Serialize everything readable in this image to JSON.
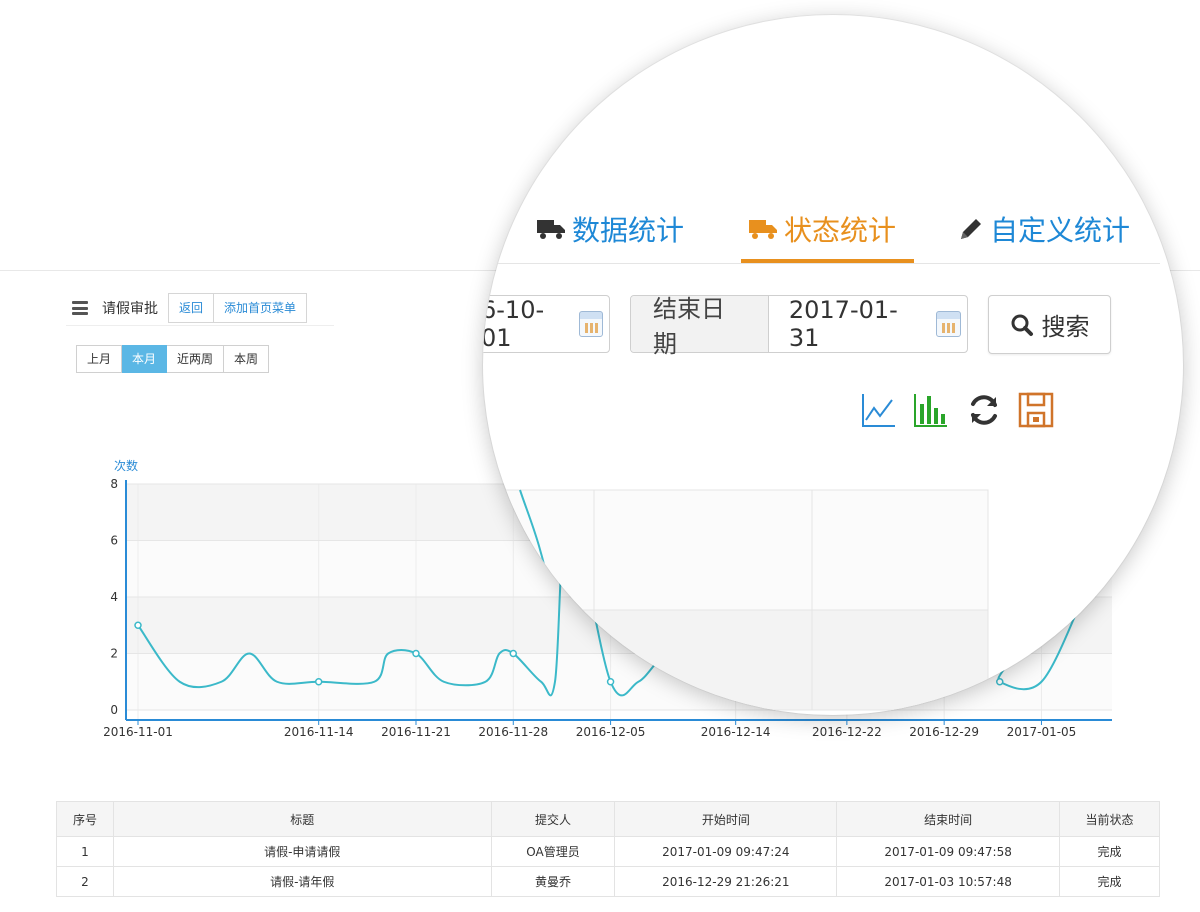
{
  "header": {
    "title": "请假审批",
    "back_label": "返回",
    "add_menu_label": "添加首页菜单"
  },
  "period_buttons": [
    "上月",
    "本月",
    "近两周",
    "本周"
  ],
  "active_period": "本月",
  "chart_data": {
    "type": "line",
    "ylabel": "次数",
    "ylim": [
      0,
      8
    ],
    "yticks": [
      0,
      2,
      4,
      6,
      8
    ],
    "x_ticks": [
      "2016-11-01",
      "2016-11-14",
      "2016-11-21",
      "2016-11-28",
      "2016-12-05",
      "2016-12-14",
      "2016-12-22",
      "2016-12-29",
      "2017-01-05"
    ],
    "series": [
      {
        "color": "#3bb9c9",
        "points": [
          {
            "x": "2016-11-01",
            "y": 3
          },
          {
            "x": "2016-11-04",
            "y": 1
          },
          {
            "x": "2016-11-07",
            "y": 1
          },
          {
            "x": "2016-11-09",
            "y": 2
          },
          {
            "x": "2016-11-11",
            "y": 1
          },
          {
            "x": "2016-11-14",
            "y": 1
          },
          {
            "x": "2016-11-18",
            "y": 1
          },
          {
            "x": "2016-11-19",
            "y": 2
          },
          {
            "x": "2016-11-21",
            "y": 2
          },
          {
            "x": "2016-11-23",
            "y": 1
          },
          {
            "x": "2016-11-26",
            "y": 1
          },
          {
            "x": "2016-11-27",
            "y": 2
          },
          {
            "x": "2016-11-28",
            "y": 2
          },
          {
            "x": "2016-11-30",
            "y": 1
          },
          {
            "x": "2016-12-01",
            "y": 1
          },
          {
            "x": "2016-12-02",
            "y": 7
          },
          {
            "x": "2016-12-05",
            "y": 1
          },
          {
            "x": "2016-12-07",
            "y": 1
          },
          {
            "x": "2016-12-09",
            "y": 2
          },
          {
            "x": "2016-12-11",
            "y": 2
          },
          {
            "x": "2016-12-14",
            "y": 1
          },
          {
            "x": "2017-01-01",
            "y": 2
          },
          {
            "x": "2017-01-02",
            "y": 1
          },
          {
            "x": "2017-01-05",
            "y": 1
          },
          {
            "x": "2017-01-08",
            "y": 4
          }
        ],
        "markers": [
          "2016-11-01",
          "2016-11-14",
          "2016-11-21",
          "2016-11-28",
          "2016-12-05",
          "2016-12-14",
          "2017-01-02"
        ]
      }
    ]
  },
  "table": {
    "columns": [
      "序号",
      "标题",
      "提交人",
      "开始时间",
      "结束时间",
      "当前状态"
    ],
    "rows": [
      [
        "1",
        "请假-申请请假",
        "OA管理员",
        "2017-01-09 09:47:24",
        "2017-01-09 09:47:58",
        "完成"
      ],
      [
        "2",
        "请假-请年假",
        "黄曼乔",
        "2016-12-29 21:26:21",
        "2017-01-03 10:57:48",
        "完成"
      ]
    ]
  },
  "magnifier": {
    "tabs": [
      {
        "label": "数据统计",
        "icon": "truck-icon",
        "color": "#1e88d6"
      },
      {
        "label": "状态统计",
        "icon": "truck-icon",
        "color": "#e8901e"
      },
      {
        "label": "自定义统计",
        "icon": "pencil-icon",
        "color": "#1e88d6"
      }
    ],
    "active_tab": "状态统计",
    "start_date_value": "6-10-01",
    "end_date_label": "结束日期",
    "end_date_value": "2017-01-31",
    "search_label": "搜索",
    "tools": [
      {
        "icon": "line-chart-icon",
        "color": "#2a8bd6"
      },
      {
        "icon": "bar-chart-icon",
        "color": "#2aa52a"
      },
      {
        "icon": "refresh-icon",
        "color": "#333333"
      },
      {
        "icon": "save-icon",
        "color": "#d0742a"
      }
    ]
  }
}
